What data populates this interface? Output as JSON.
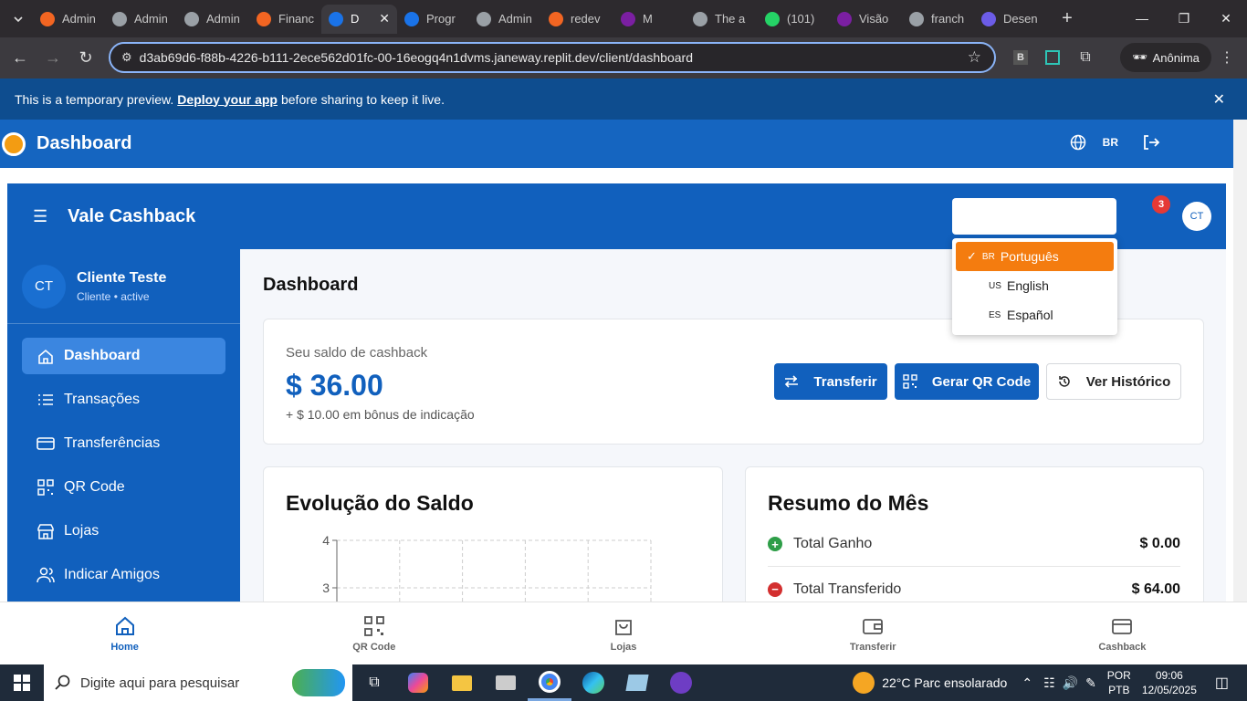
{
  "browser": {
    "tabs": [
      {
        "label": "Admin",
        "color": "#f26522"
      },
      {
        "label": "Admin",
        "color": "#9aa0a6"
      },
      {
        "label": "Admin",
        "color": "#9aa0a6"
      },
      {
        "label": "Financ",
        "color": "#f26522"
      },
      {
        "label": "D",
        "color": "#1a73e8"
      },
      {
        "label": "Progr",
        "color": "#1a73e8"
      },
      {
        "label": "Admin",
        "color": "#9aa0a6"
      },
      {
        "label": "redev",
        "color": "#f26522"
      },
      {
        "label": "M",
        "color": "#7b1fa2"
      },
      {
        "label": "The a",
        "color": "#9aa0a6"
      },
      {
        "label": "(101)",
        "color": "#25d366"
      },
      {
        "label": "Visão",
        "color": "#7b1fa2"
      },
      {
        "label": "franch",
        "color": "#9aa0a6"
      },
      {
        "label": "Desen",
        "color": "#6c5ce7"
      }
    ],
    "url": "d3ab69d6-f88b-4226-b111-2ece562d01fc-00-16eogq4n1dvms.janeway.replit.dev/client/dashboard",
    "ext_b": "B",
    "incognito": "Anônima"
  },
  "preview_banner": {
    "prefix": "This is a temporary preview.",
    "link": "Deploy your app",
    "suffix": "before sharing to keep it live."
  },
  "app_header": {
    "title": "Dashboard",
    "lang": "BR"
  },
  "inner_header": {
    "brand": "Vale Cashback",
    "notifications": "3",
    "avatar": "CT"
  },
  "language_menu": [
    {
      "code": "BR",
      "label": "Português",
      "selected": true
    },
    {
      "code": "US",
      "label": "English",
      "selected": false
    },
    {
      "code": "ES",
      "label": "Español",
      "selected": false
    }
  ],
  "profile": {
    "initials": "CT",
    "name": "Cliente Teste",
    "sub": "Cliente • active"
  },
  "sidebar": [
    {
      "label": "Dashboard",
      "icon": "home-icon"
    },
    {
      "label": "Transações",
      "icon": "list-icon"
    },
    {
      "label": "Transferências",
      "icon": "card-icon"
    },
    {
      "label": "QR Code",
      "icon": "qr-icon"
    },
    {
      "label": "Lojas",
      "icon": "store-icon"
    },
    {
      "label": "Indicar Amigos",
      "icon": "users-icon"
    }
  ],
  "main": {
    "title": "Dashboard",
    "balance_label": "Seu saldo de cashback",
    "balance_value": "$ 36.00",
    "bonus": "+ $ 10.00 em bônus de indicação",
    "btn_transfer": "Transferir",
    "btn_qr": "Gerar QR Code",
    "btn_history": "Ver Histórico"
  },
  "chart_data": {
    "type": "line",
    "title": "Evolução do Saldo",
    "y_ticks_visible": [
      "4",
      "3"
    ],
    "grid": true
  },
  "summary": {
    "title": "Resumo do Mês",
    "rows": [
      {
        "label": "Total Ganho",
        "value": "$ 0.00",
        "color": "#2e9e48"
      },
      {
        "label": "Total Transferido",
        "value": "$ 64.00",
        "color": "#d32f2f"
      }
    ]
  },
  "bottom_nav": [
    {
      "label": "Home",
      "icon": "home-icon",
      "active": true
    },
    {
      "label": "QR Code",
      "icon": "qr-icon",
      "active": false
    },
    {
      "label": "Lojas",
      "icon": "bag-icon",
      "active": false
    },
    {
      "label": "Transferir",
      "icon": "wallet-icon",
      "active": false
    },
    {
      "label": "Cashback",
      "icon": "card-icon",
      "active": false
    }
  ],
  "taskbar": {
    "search": "Digite aqui para pesquisar",
    "weather": "22°C  Parc ensolarado",
    "lang1": "POR",
    "lang2": "PTB",
    "time": "09:06",
    "date": "12/05/2025"
  }
}
